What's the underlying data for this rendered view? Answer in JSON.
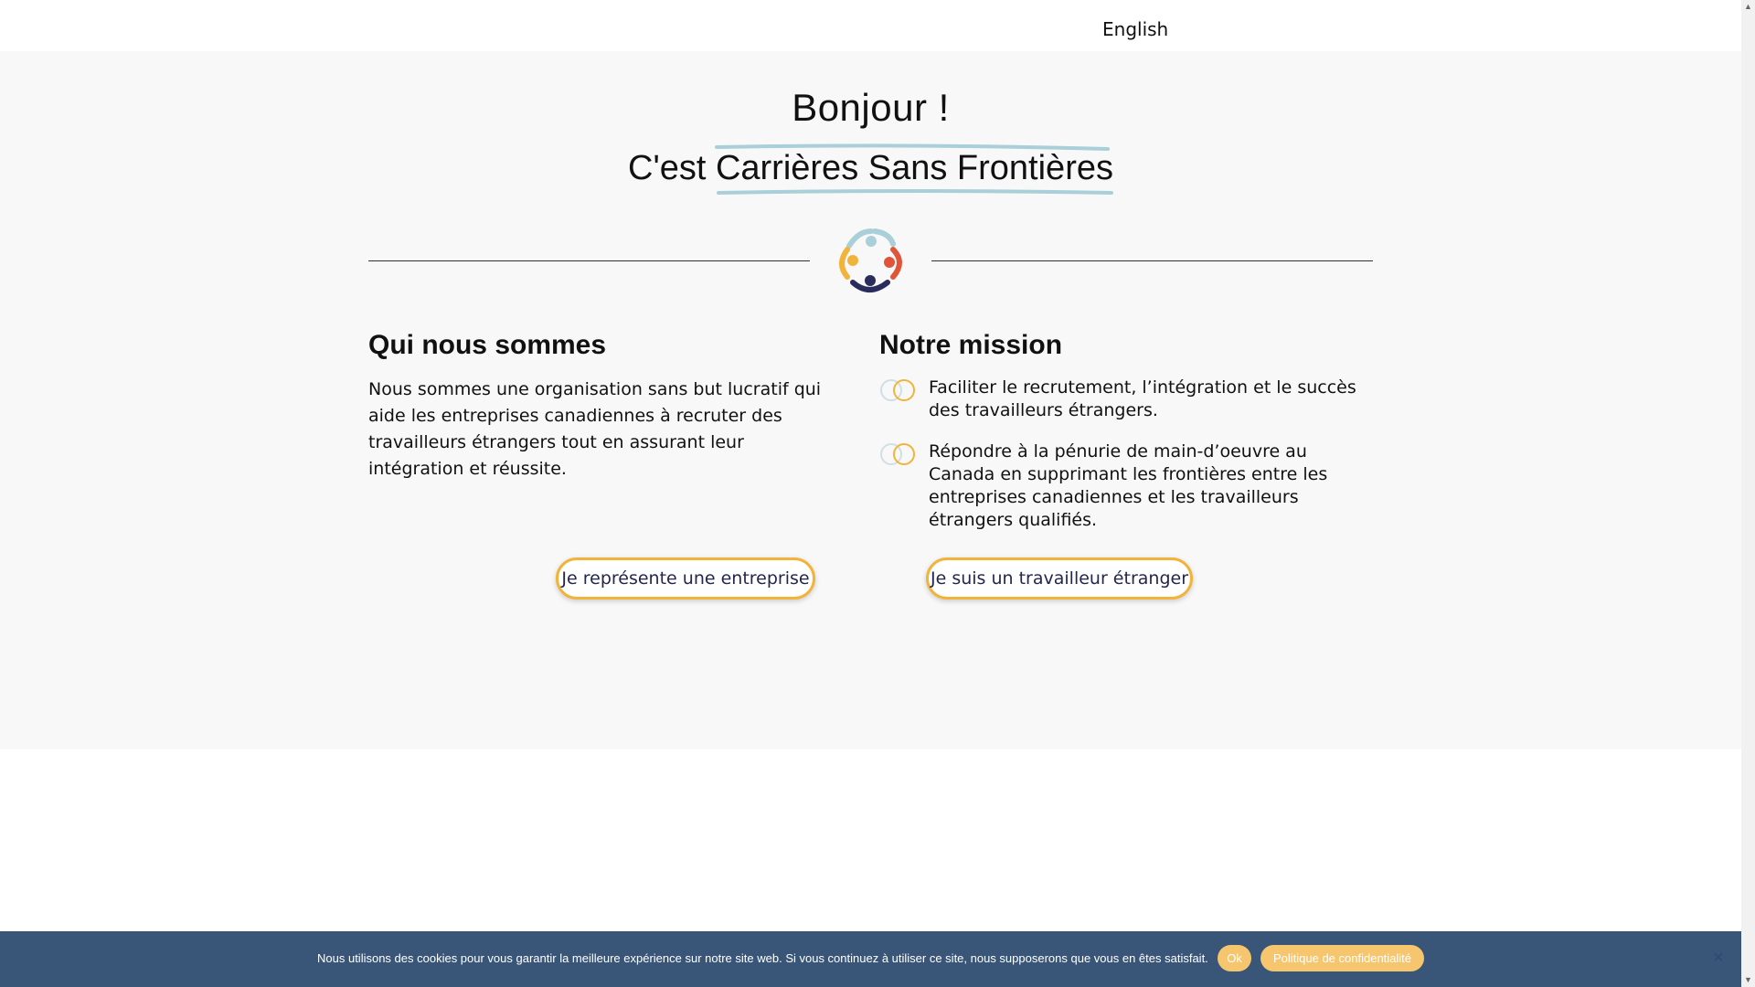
{
  "header": {
    "language_link": "English"
  },
  "hero": {
    "greeting": "Bonjour !",
    "subtitle": "C'est Carrières Sans Frontières",
    "logo_icon": "people-circle-logo-icon"
  },
  "who": {
    "title": "Qui nous sommes",
    "text": "Nous sommes une organisation sans but lucratif qui aide les entreprises canadiennes à recruter des travailleurs étrangers tout en assurant leur intégration et réussite."
  },
  "mission": {
    "title": "Notre mission",
    "items": [
      {
        "text": "Faciliter le recrutement, l’intégration et le succès des travailleurs étrangers."
      },
      {
        "text": "Répondre à la pénurie de main-d’oeuvre au Canada en supprimant les frontières entre les entreprises canadiennes et les travailleurs étrangers qualifiés."
      }
    ]
  },
  "cta": {
    "business": "Je représente une entreprise",
    "worker": "Je suis un travailleur étranger"
  },
  "cookie": {
    "text": "Nous utilisons des cookies pour vous garantir la meilleure expérience sur notre site web. Si vous continuez à utiliser ce site, nous supposerons que vous en êtes satisfait.",
    "ok": "Ok",
    "privacy": "Politique de confidentialité",
    "close": "×"
  },
  "colors": {
    "accent_yellow": "#f2b33a",
    "underline_blue": "#a9cfd8",
    "logo_red": "#e0553a",
    "logo_navy": "#2a2d5c",
    "cookie_bg": "#28486e",
    "cookie_button": "#f6c66f"
  }
}
